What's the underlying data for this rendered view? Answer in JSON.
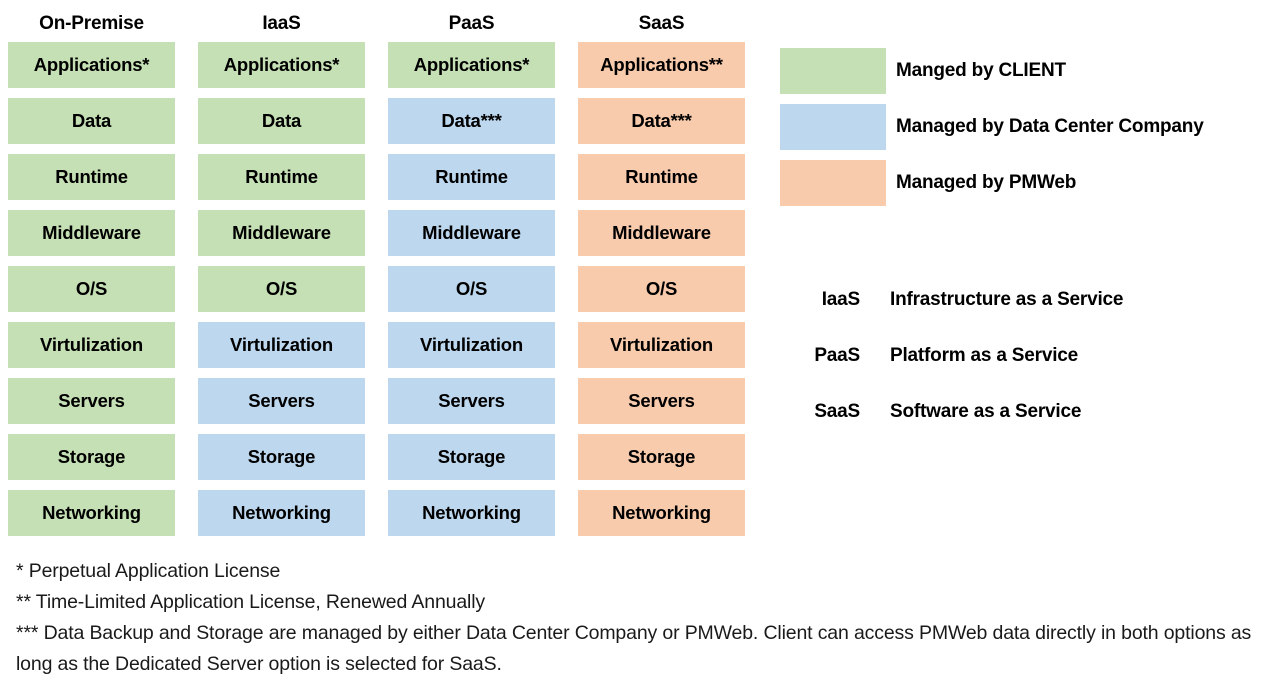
{
  "colors": {
    "client": "#c5e0b4",
    "datacenter": "#bdd7ee",
    "pmweb": "#f8cbad",
    "text": "#000000",
    "background": "#ffffff"
  },
  "matrix": {
    "columns": [
      {
        "header": "On-Premise"
      },
      {
        "header": "IaaS"
      },
      {
        "header": "PaaS"
      },
      {
        "header": "SaaS"
      }
    ],
    "rows": [
      {
        "layer": "Applications",
        "cells": [
          {
            "label": "Applications*",
            "owner": "client"
          },
          {
            "label": "Applications*",
            "owner": "client"
          },
          {
            "label": "Applications*",
            "owner": "client"
          },
          {
            "label": "Applications**",
            "owner": "pmweb"
          }
        ]
      },
      {
        "layer": "Data",
        "cells": [
          {
            "label": "Data",
            "owner": "client"
          },
          {
            "label": "Data",
            "owner": "client"
          },
          {
            "label": "Data***",
            "owner": "datacenter"
          },
          {
            "label": "Data***",
            "owner": "pmweb"
          }
        ]
      },
      {
        "layer": "Runtime",
        "cells": [
          {
            "label": "Runtime",
            "owner": "client"
          },
          {
            "label": "Runtime",
            "owner": "client"
          },
          {
            "label": "Runtime",
            "owner": "datacenter"
          },
          {
            "label": "Runtime",
            "owner": "pmweb"
          }
        ]
      },
      {
        "layer": "Middleware",
        "cells": [
          {
            "label": "Middleware",
            "owner": "client"
          },
          {
            "label": "Middleware",
            "owner": "client"
          },
          {
            "label": "Middleware",
            "owner": "datacenter"
          },
          {
            "label": "Middleware",
            "owner": "pmweb"
          }
        ]
      },
      {
        "layer": "O/S",
        "cells": [
          {
            "label": "O/S",
            "owner": "client"
          },
          {
            "label": "O/S",
            "owner": "client"
          },
          {
            "label": "O/S",
            "owner": "datacenter"
          },
          {
            "label": "O/S",
            "owner": "pmweb"
          }
        ]
      },
      {
        "layer": "Virtulization",
        "cells": [
          {
            "label": "Virtulization",
            "owner": "client"
          },
          {
            "label": "Virtulization",
            "owner": "datacenter"
          },
          {
            "label": "Virtulization",
            "owner": "datacenter"
          },
          {
            "label": "Virtulization",
            "owner": "pmweb"
          }
        ]
      },
      {
        "layer": "Servers",
        "cells": [
          {
            "label": "Servers",
            "owner": "client"
          },
          {
            "label": "Servers",
            "owner": "datacenter"
          },
          {
            "label": "Servers",
            "owner": "datacenter"
          },
          {
            "label": "Servers",
            "owner": "pmweb"
          }
        ]
      },
      {
        "layer": "Storage",
        "cells": [
          {
            "label": "Storage",
            "owner": "client"
          },
          {
            "label": "Storage",
            "owner": "datacenter"
          },
          {
            "label": "Storage",
            "owner": "datacenter"
          },
          {
            "label": "Storage",
            "owner": "pmweb"
          }
        ]
      },
      {
        "layer": "Networking",
        "cells": [
          {
            "label": "Networking",
            "owner": "client"
          },
          {
            "label": "Networking",
            "owner": "datacenter"
          },
          {
            "label": "Networking",
            "owner": "datacenter"
          },
          {
            "label": "Networking",
            "owner": "pmweb"
          }
        ]
      }
    ]
  },
  "legend": {
    "items": [
      {
        "owner": "client",
        "label": "Manged by CLIENT"
      },
      {
        "owner": "datacenter",
        "label": "Managed by Data Center Company"
      },
      {
        "owner": "pmweb",
        "label": "Managed by PMWeb"
      }
    ]
  },
  "acronyms": {
    "items": [
      {
        "key": "IaaS",
        "description": "Infrastructure as a Service"
      },
      {
        "key": "PaaS",
        "description": "Platform as a Service"
      },
      {
        "key": "SaaS",
        "description": "Software as a Service"
      }
    ]
  },
  "footnotes": [
    "* Perpetual Application License",
    "** Time-Limited Application License, Renewed Annually",
    "*** Data Backup and Storage are managed by either Data Center Company or PMWeb. Client can access PMWeb data directly in both options as long as the Dedicated Server option is selected for SaaS."
  ]
}
